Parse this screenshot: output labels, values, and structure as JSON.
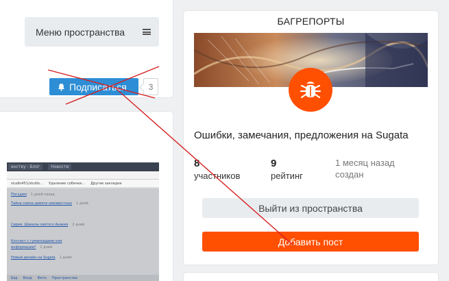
{
  "left_panel": {
    "menu_label": "Меню пространства",
    "subscribe_label": "Подписаться",
    "subscriber_count": "3"
  },
  "embedded_screenshot": {
    "tabs": [
      "енству - Блог",
      "Новости"
    ],
    "bookmarks": [
      "studio451/studio…",
      "Удаление собачки…",
      "Другие закладки"
    ],
    "lines": [
      {
        "link": "Погудим",
        "time": "1 дней назад"
      },
      {
        "link": "Тайна союза девяти неизвестных",
        "time": "1 дней"
      },
      {
        "link": "Сирия. Шакалы святого Акакия",
        "time": "2 дней"
      },
      {
        "link": "Контакт с гуманоидами или",
        "time": ""
      },
      {
        "link": "информации?",
        "time": "1 дней"
      },
      {
        "link": "Новый дизайн на Sugata",
        "time": "1 дней"
      }
    ],
    "footer": [
      "Бар",
      "Вход",
      "Фото",
      "Пространства"
    ]
  },
  "space": {
    "title": "БАГРЕПОРТЫ",
    "description": "Ошибки, замечания, предложения на Sugata",
    "stats": {
      "members_value": "8",
      "members_label": "участников",
      "rating_value": "9",
      "rating_label": "рейтинг",
      "created_value": "1 месяц назад",
      "created_label": "создан"
    },
    "leave_label": "Выйти из пространства",
    "add_post_label": "Добавить пост",
    "accent_color": "#ff4f00",
    "icon": "bug-icon"
  }
}
